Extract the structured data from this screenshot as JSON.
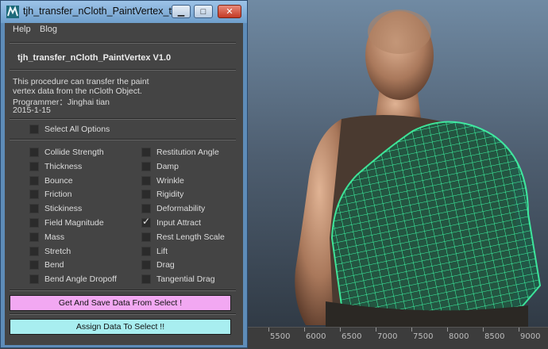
{
  "window": {
    "title": "tjh_transfer_nCloth_PaintVertex_t...",
    "min_glyph": "▁",
    "max_glyph": "□",
    "close_glyph": "✕"
  },
  "menu": [
    {
      "label": "Help"
    },
    {
      "label": "Blog"
    }
  ],
  "header": "tjh_transfer_nCloth_PaintVertex V1.0",
  "description": [
    "This procedure can  transfer the paint",
    "vertex  data from the nCloth Object.",
    "Programmer：Jinghai tian",
    "2015-1-15"
  ],
  "select_all": {
    "label": "Select All Options",
    "checked": false
  },
  "options_left": [
    {
      "label": "Collide Strength",
      "checked": false
    },
    {
      "label": "Thickness",
      "checked": false
    },
    {
      "label": "Bounce",
      "checked": false
    },
    {
      "label": "Friction",
      "checked": false
    },
    {
      "label": "Stickiness",
      "checked": false
    },
    {
      "label": "Field Magnitude",
      "checked": false
    },
    {
      "label": "Mass",
      "checked": false
    },
    {
      "label": "Stretch",
      "checked": false
    },
    {
      "label": "Bend",
      "checked": false
    },
    {
      "label": "Bend Angle Dropoff",
      "checked": false
    }
  ],
  "options_right": [
    {
      "label": "Restitution Angle",
      "checked": false
    },
    {
      "label": "Damp",
      "checked": false
    },
    {
      "label": "Wrinkle",
      "checked": false
    },
    {
      "label": "Rigidity",
      "checked": false
    },
    {
      "label": "Deformability",
      "checked": false
    },
    {
      "label": "Input Attract",
      "checked": true
    },
    {
      "label": "Rest Length Scale",
      "checked": false
    },
    {
      "label": "Lift",
      "checked": false
    },
    {
      "label": "Drag",
      "checked": false
    },
    {
      "label": "Tangential Drag",
      "checked": false
    }
  ],
  "buttons": {
    "get_save": "Get And Save Data From Select !",
    "assign": "Assign Data To Select !!"
  },
  "timeline_ticks": [
    "5500",
    "6000",
    "6500",
    "7000",
    "7500",
    "8000",
    "8500",
    "9000"
  ],
  "colors": {
    "get_button": "#f2a8f2",
    "assign_button": "#a8eef0",
    "wireframe": "#3dffa8"
  }
}
